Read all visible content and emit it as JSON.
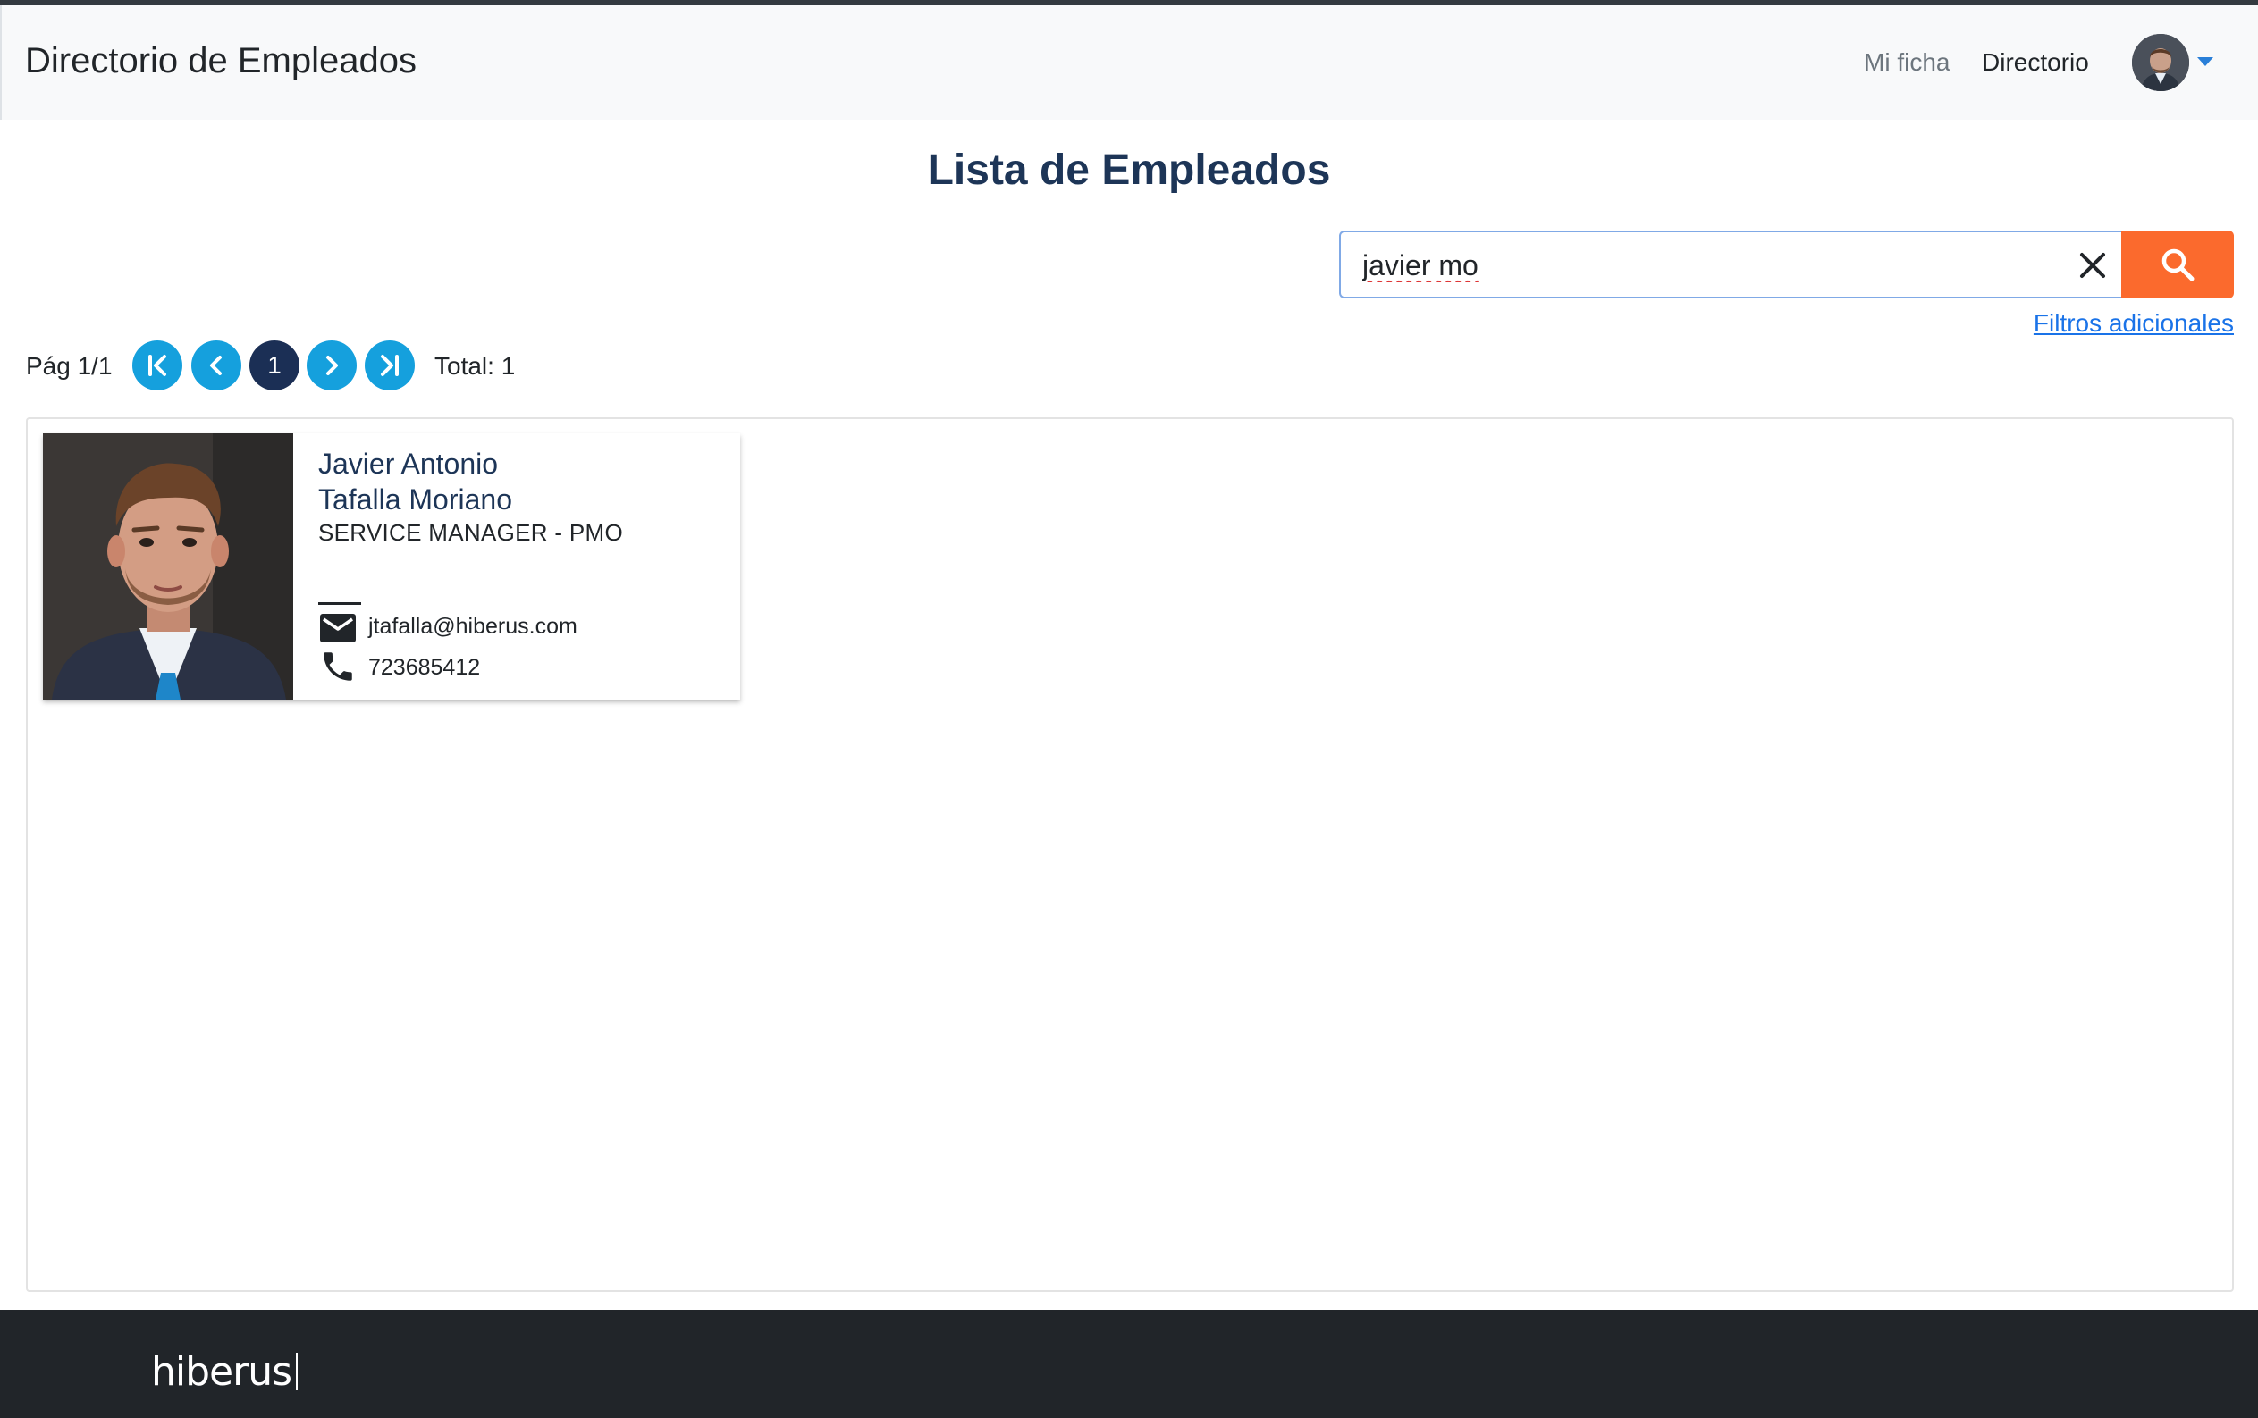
{
  "header": {
    "brand": "Directorio de Empleados",
    "nav": [
      "Mi ficha",
      "Directorio"
    ],
    "avatar_icon": "user-avatar",
    "caret_icon": "chevron-down-icon"
  },
  "main": {
    "title": "Lista de Empleados",
    "search": {
      "value": "javier mo",
      "clear_icon": "close-icon",
      "button_icon": "search-icon"
    },
    "extra_filters_link": "Filtros adicionales"
  },
  "pagination": {
    "page_label": "Pág 1/1",
    "current_page": "1",
    "total_label": "Total: 1",
    "buttons": [
      "first-page-icon",
      "previous-page-icon",
      "next-page-icon",
      "last-page-icon"
    ]
  },
  "employees": [
    {
      "name_line1": "Javier Antonio",
      "name_line2": "Tafalla Moriano",
      "role": "SERVICE MANAGER - PMO",
      "email": "jtafalla@hiberus.com",
      "phone": "723685412"
    }
  ],
  "footer": {
    "logo": "hiberus"
  },
  "colors": {
    "navbar_bg": "#f8f9fa",
    "accent_orange": "#fb6a2d",
    "pager_blue": "#15a0dd",
    "pager_current": "#1b2f55",
    "title_blue": "#1d3557",
    "link_blue": "#1a73e8",
    "footer_bg": "#212529"
  }
}
